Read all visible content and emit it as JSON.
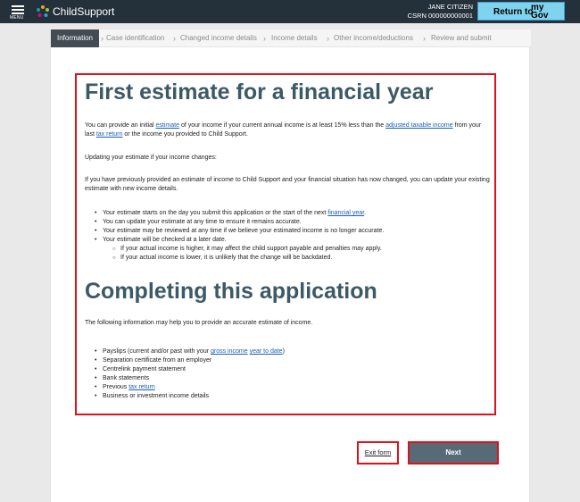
{
  "header": {
    "menu_label": "MENU",
    "brand": "ChildSupport",
    "user_name": "JANE CITIZEN",
    "user_csrn": "CSRN 000000000001",
    "return_label": "Return to",
    "mygov_top": "my",
    "mygov_bottom": "Gov"
  },
  "steps": [
    "Information",
    "Case identification",
    "Changed income details",
    "Income details",
    "Other income/deductions",
    "Review and submit"
  ],
  "section1": {
    "heading": "First estimate for a financial year",
    "p1": {
      "t1": "You can provide an initial ",
      "link1": "estimate",
      "t2": " of your income if your current annual income is at least 15% less than the ",
      "link2": "adjusted taxable income",
      "t3": " from your last ",
      "link3": "tax return",
      "t4": " or the income you provided to Child Support."
    },
    "p2": "Updating your estimate if your income changes:",
    "p3": "If you have previously provided an estimate of income to Child Support and your financial situation has now changed, you can update your existing estimate with new income details.",
    "bullets": {
      "b1_text": "Your estimate starts on the day you submit this application or the start of the next ",
      "b1_link": "financial year",
      "b1_end": ".",
      "b2": "You can update your estimate at any time to ensure it remains accurate.",
      "b3": "Your estimate may be reviewed at any time if we believe your estimated income is no longer accurate.",
      "b4": "Your estimate will be checked at a later date.",
      "s1": "If your actual income is higher, it may affect the child support payable and penalties may apply.",
      "s2": "If your actual income is lower, it is unlikely that the change will be backdated."
    }
  },
  "section2": {
    "heading": "Completing this application",
    "p1": "The following information may help you to provide an accurate estimate of income.",
    "bullets": {
      "b1_text": "Payslips (current and/or past with your ",
      "b1_link1": "gross income",
      "b1_link2": "year to date",
      "b1_end": ")",
      "b2": "Separation certificate from an employer",
      "b3": "Centrelink payment statement",
      "b4": "Bank statements",
      "b5_text": "Previous ",
      "b5_link": "tax return",
      "b6": "Business or investment income details"
    }
  },
  "actions": {
    "exit": "Exit form",
    "next": "Next"
  }
}
